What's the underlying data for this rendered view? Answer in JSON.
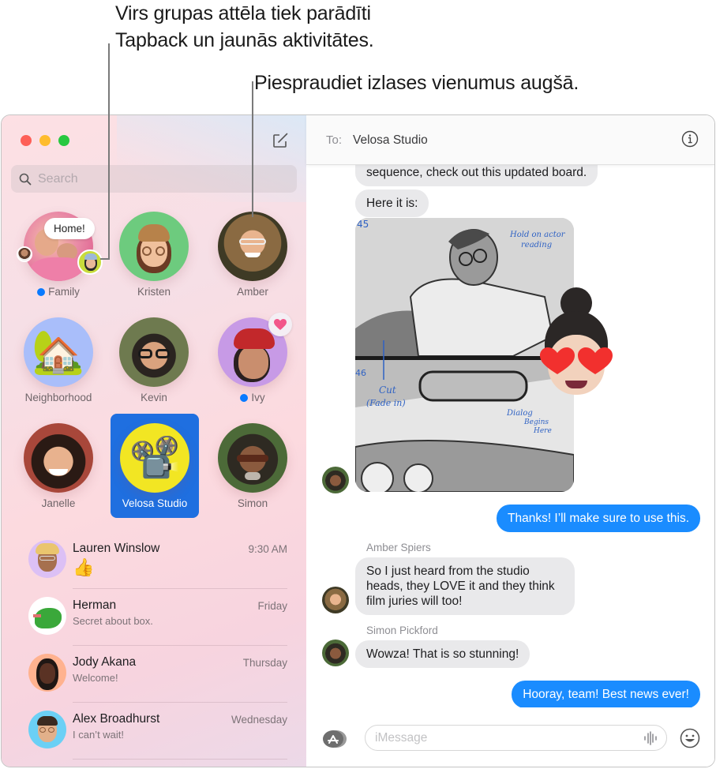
{
  "callouts": {
    "group_tapback": {
      "line1": "Virs grupas attēla tiek parādīti",
      "line2": "Tapback un jaunās aktivitātes."
    },
    "pin_favorites": "Piespraudiet izlases vienumus augšā."
  },
  "sidebar": {
    "window_controls": [
      "close",
      "minimize",
      "zoom"
    ],
    "compose_icon": "compose-icon",
    "search": {
      "placeholder": "Search",
      "value": ""
    },
    "pinned": [
      {
        "name": "Family",
        "unread": true,
        "tapback_bubble": "Home!",
        "avatar_color": "#f2a3b4"
      },
      {
        "name": "Kristen",
        "unread": false,
        "avatar_color": "#6dcb7e"
      },
      {
        "name": "Amber",
        "unread": false,
        "avatar_color": "#6b5a3a"
      },
      {
        "name": "Neighborhood",
        "unread": false,
        "avatar_color": "#a9befa",
        "emoji": "🏡"
      },
      {
        "name": "Kevin",
        "unread": false,
        "avatar_color": "#5d6b45"
      },
      {
        "name": "Ivy",
        "unread": true,
        "tapback": "heart",
        "avatar_color": "#c79ae6"
      },
      {
        "name": "Janelle",
        "unread": false,
        "avatar_color": "#a8473a"
      },
      {
        "name": "Velosa Studio",
        "unread": false,
        "selected": true,
        "avatar_color": "#f2e623",
        "emoji": "📽️"
      },
      {
        "name": "Simon",
        "unread": false,
        "avatar_color": "#4c6a38"
      }
    ],
    "conversations": [
      {
        "name": "Lauren Winslow",
        "time": "9:30 AM",
        "preview": "👍",
        "avatar_color": "#dcc0f5"
      },
      {
        "name": "Herman",
        "time": "Friday",
        "preview": "Secret about box.",
        "avatar_color": "#ffffff"
      },
      {
        "name": "Jody Akana",
        "time": "Thursday",
        "preview": "Welcome!",
        "avatar_color": "#ffb28f"
      },
      {
        "name": "Alex Broadhurst",
        "time": "Wednesday",
        "preview": "I can’t wait!",
        "avatar_color": "#6bd0f5"
      }
    ]
  },
  "chat": {
    "to_label": "To:",
    "recipient": "Velosa Studio",
    "info_icon": "info-icon",
    "messages": [
      {
        "direction": "in",
        "text": "sequence, check out this updated board."
      },
      {
        "direction": "in",
        "text": "Here it is:"
      },
      {
        "direction": "in",
        "type": "image",
        "description": "storyboard sketch",
        "annotations": [
          "45",
          "Hold on actor reading",
          "46",
          "Cut (Fade in)",
          "Dialog Begins Here"
        ],
        "sticker": "heart-eyes memoji"
      },
      {
        "direction": "out",
        "text": "Thanks! I’ll make sure to use this."
      },
      {
        "direction": "in",
        "sender": "Amber Spiers",
        "text": "So I just heard from the studio heads, they LOVE it and they think film juries will too!"
      },
      {
        "direction": "in",
        "sender": "Simon Pickford",
        "text": "Wowza! That is so stunning!"
      },
      {
        "direction": "out",
        "text": "Hooray, team! Best news ever!"
      }
    ],
    "composer": {
      "placeholder": "iMessage",
      "value": ""
    }
  },
  "colors": {
    "accent_blue": "#1a8cff",
    "selected_pin": "#1f6fe0",
    "incoming_bubble": "#e9e9eb",
    "unread_dot": "#0a7aff"
  }
}
